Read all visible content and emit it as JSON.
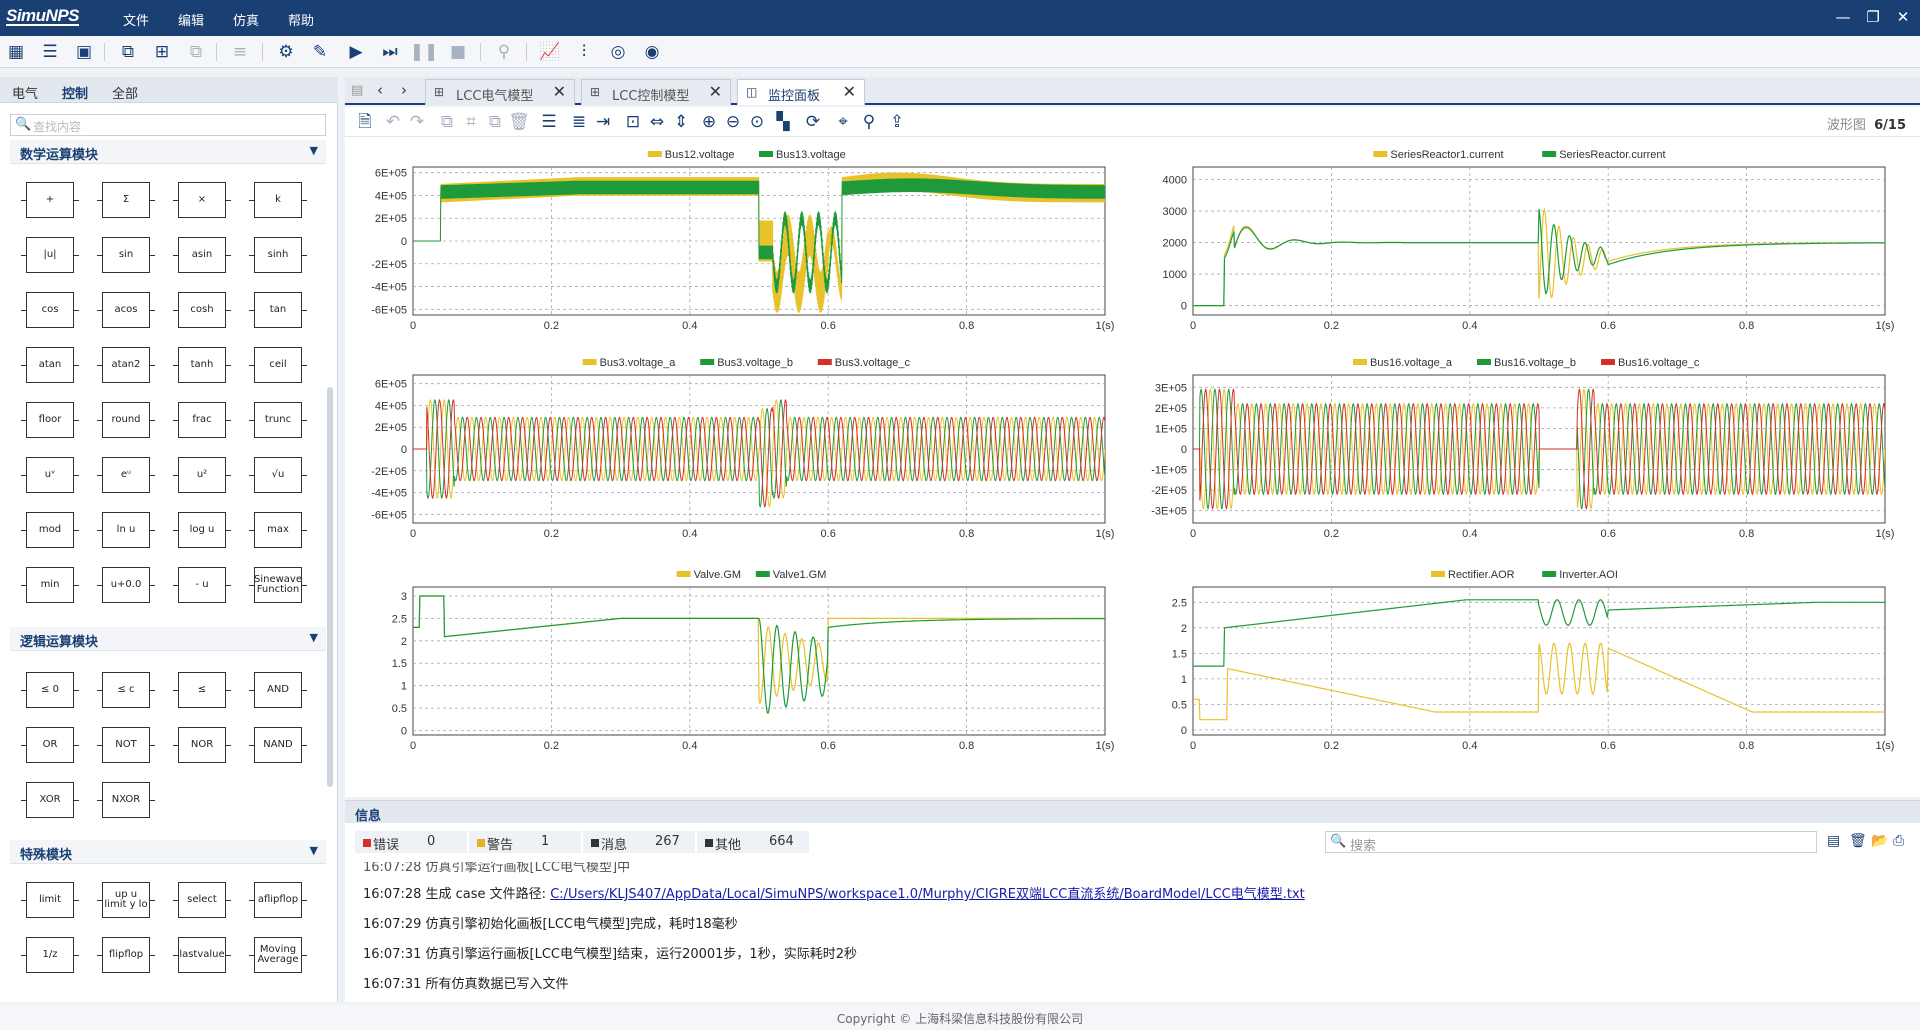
{
  "app": {
    "logo": "SimuNPS",
    "menus": [
      "文件",
      "编辑",
      "仿真",
      "帮助"
    ]
  },
  "left": {
    "tabs": [
      "电气",
      "控制",
      "全部"
    ],
    "search_placeholder": "查找内容",
    "cat1": "数学运算模块",
    "cat2": "逻辑运算模块",
    "cat3": "特殊模块",
    "math_blocks": [
      "+",
      "Σ",
      "×",
      "k",
      "|u|",
      "sin",
      "asin",
      "sinh",
      "cos",
      "acos",
      "cosh",
      "tan",
      "atan",
      "atan2",
      "tanh",
      "ceil",
      "floor",
      "round",
      "frac",
      "trunc",
      "uᵛ",
      "eᵘ",
      "u²",
      "√u",
      "mod",
      "ln u",
      "log u",
      "max",
      "min",
      "u+0.0",
      "- u",
      "Sinewave Function"
    ],
    "logic_blocks": [
      "≤ 0",
      "≤ c",
      "≤",
      "AND",
      "OR",
      "NOT",
      "NOR",
      "NAND",
      "XOR",
      "NXOR"
    ],
    "special_blocks": [
      "limit",
      "up u limit y lo",
      "select",
      "aflipflop",
      "1/z",
      "flipflop",
      "lastvalue",
      "Moving Average"
    ]
  },
  "tabs": [
    "LCC电气模型",
    "LCC控制模型",
    "监控面板"
  ],
  "pager": {
    "label": "波形图",
    "value": "6/15"
  },
  "plots": [
    {
      "legend": [
        "Bus12.voltage",
        "Bus13.voltage"
      ],
      "yticks": [
        "6E+05",
        "4E+05",
        "2E+05",
        "0",
        "-2E+05",
        "-4E+05",
        "-6E+05"
      ]
    },
    {
      "legend": [
        "SeriesReactor1.current",
        "SeriesReactor.current"
      ],
      "yticks": [
        "4000",
        "3000",
        "2000",
        "1000",
        "0"
      ]
    },
    {
      "legend": [
        "Bus3.voltage_a",
        "Bus3.voltage_b",
        "Bus3.voltage_c"
      ],
      "yticks": [
        "6E+05",
        "4E+05",
        "2E+05",
        "0",
        "-2E+05",
        "-4E+05",
        "-6E+05"
      ]
    },
    {
      "legend": [
        "Bus16.voltage_a",
        "Bus16.voltage_b",
        "Bus16.voltage_c"
      ],
      "yticks": [
        "3E+05",
        "2E+05",
        "1E+05",
        "0",
        "-1E+05",
        "-2E+05",
        "-3E+05"
      ]
    },
    {
      "legend": [
        "Valve.GM",
        "Valve1.GM"
      ],
      "yticks": [
        "3",
        "2.5",
        "2",
        "1.5",
        "1",
        "0.5",
        "0"
      ]
    },
    {
      "legend": [
        "Rectifier.AOR",
        "Inverter.AOI"
      ],
      "yticks": [
        "2.5",
        "2",
        "1.5",
        "1",
        "0.5",
        "0"
      ]
    }
  ],
  "xticks": [
    "0",
    "0.2",
    "0.4",
    "0.6",
    "0.8",
    "1(s)"
  ],
  "colors": {
    "yellow": "#e8c22a",
    "green": "#1e9a3a",
    "red": "#d4302a",
    "brand": "#1a3f73"
  },
  "info": {
    "title": "信息",
    "filters": [
      {
        "label": "错误",
        "count": "0",
        "color": "#d4302a"
      },
      {
        "label": "警告",
        "count": "1",
        "color": "#e8b020"
      },
      {
        "label": "消息",
        "count": "267",
        "color": "#333333"
      },
      {
        "label": "其他",
        "count": "664",
        "color": "#333333"
      }
    ],
    "search_placeholder": "搜索",
    "logs": [
      {
        "time": "16:07:28",
        "text": "仿真引擎运行画板[LCC电气模型]中"
      },
      {
        "time": "16:07:28",
        "text": "生成 case 文件路径:",
        "link": "C:/Users/KLJS407/AppData/Local/SimuNPS/workspace1.0/Murphy/CIGRE双端LCC直流系统/BoardModel/LCC电气模型.txt"
      },
      {
        "time": "16:07:29",
        "text": "仿真引擎初始化画板[LCC电气模型]完成，耗时18毫秒"
      },
      {
        "time": "16:07:31",
        "text": "仿真引擎运行画板[LCC电气模型]结束，运行20001步，1秒，实际耗时2秒"
      },
      {
        "time": "16:07:31",
        "text": "所有仿真数据已写入文件"
      }
    ]
  },
  "footer": "Copyright © 上海科梁信息科技股份有限公司"
}
